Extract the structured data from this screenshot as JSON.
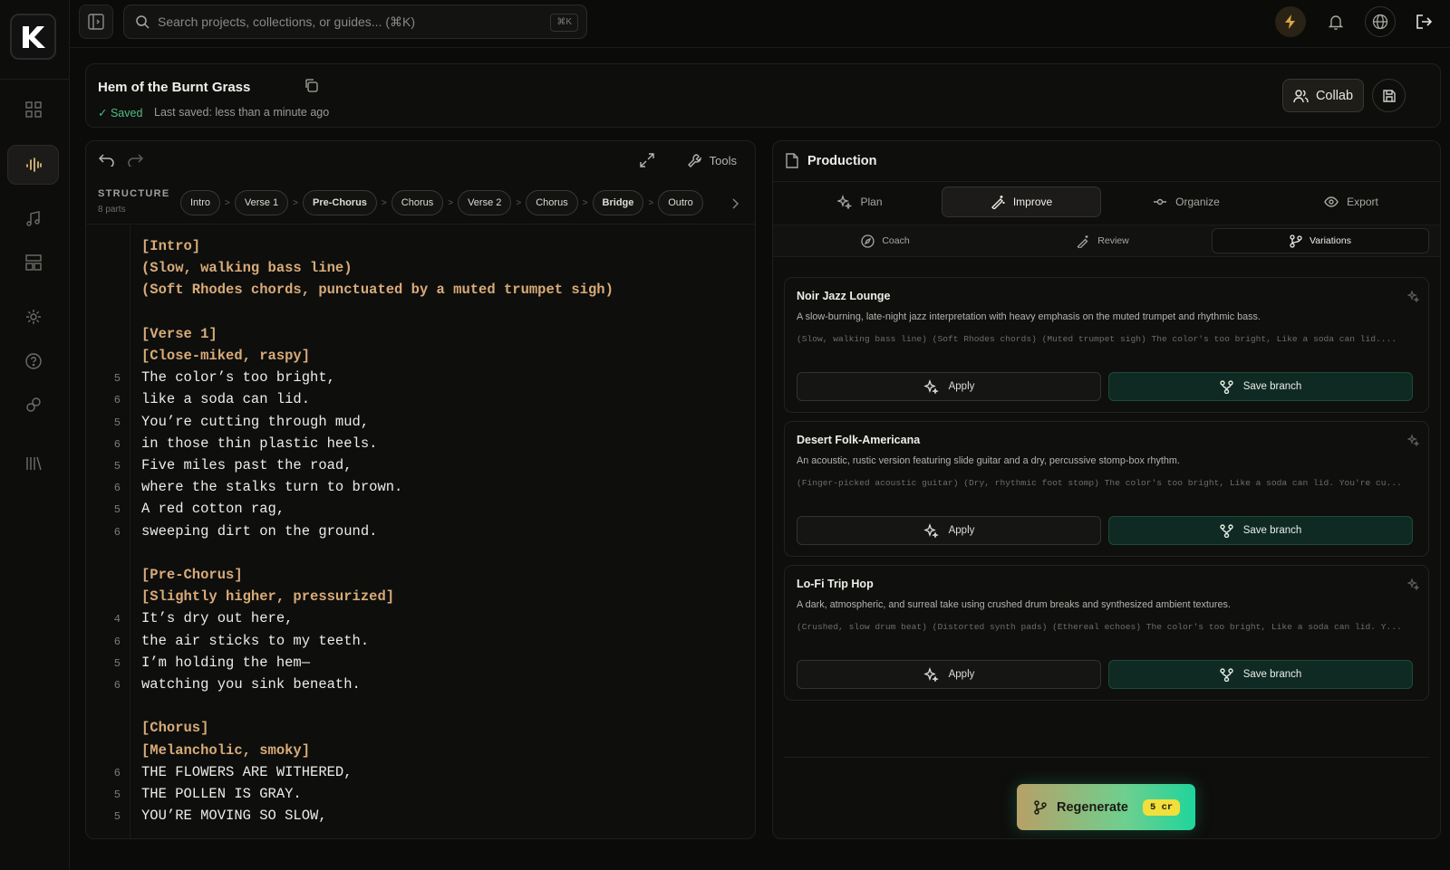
{
  "search": {
    "placeholder": "Search projects, collections, or guides... (⌘K)",
    "shortcut": "⌘K"
  },
  "project": {
    "title": "Hem of the Burnt Grass",
    "saved_label": "✓ Saved",
    "last_saved": "Last saved: less than a minute ago",
    "collab_label": "Collab"
  },
  "editor": {
    "tools_label": "Tools",
    "structure_label": "STRUCTURE",
    "structure_count": "8 parts",
    "parts": [
      "Intro",
      "Verse 1",
      "Pre-Chorus",
      "Chorus",
      "Verse 2",
      "Chorus",
      "Bridge",
      "Outro"
    ],
    "lines": [
      {
        "n": "",
        "t": "[Intro]",
        "tag": true
      },
      {
        "n": "",
        "t": "(Slow, walking bass line)",
        "tag": true
      },
      {
        "n": "",
        "t": "(Soft Rhodes chords, punctuated by a muted trumpet sigh)",
        "tag": true
      },
      {
        "n": "",
        "t": "",
        "tag": false
      },
      {
        "n": "",
        "t": "[Verse 1]",
        "tag": true
      },
      {
        "n": "",
        "t": "[Close-miked, raspy]",
        "tag": true
      },
      {
        "n": "5",
        "t": "The color’s too bright,",
        "tag": false
      },
      {
        "n": "6",
        "t": "like a soda can lid.",
        "tag": false
      },
      {
        "n": "5",
        "t": "You’re cutting through mud,",
        "tag": false
      },
      {
        "n": "6",
        "t": "in those thin plastic heels.",
        "tag": false
      },
      {
        "n": "5",
        "t": "Five miles past the road,",
        "tag": false
      },
      {
        "n": "6",
        "t": "where the stalks turn to brown.",
        "tag": false
      },
      {
        "n": "5",
        "t": "A red cotton rag,",
        "tag": false
      },
      {
        "n": "6",
        "t": "sweeping dirt on the ground.",
        "tag": false
      },
      {
        "n": "",
        "t": "",
        "tag": false
      },
      {
        "n": "",
        "t": "[Pre-Chorus]",
        "tag": true
      },
      {
        "n": "",
        "t": "[Slightly higher, pressurized]",
        "tag": true
      },
      {
        "n": "4",
        "t": "It’s dry out here,",
        "tag": false
      },
      {
        "n": "6",
        "t": "the air sticks to my teeth.",
        "tag": false
      },
      {
        "n": "5",
        "t": "I’m holding the hem—",
        "tag": false
      },
      {
        "n": "6",
        "t": "watching you sink beneath.",
        "tag": false
      },
      {
        "n": "",
        "t": "",
        "tag": false
      },
      {
        "n": "",
        "t": "[Chorus]",
        "tag": true
      },
      {
        "n": "",
        "t": "[Melancholic, smoky]",
        "tag": true
      },
      {
        "n": "6",
        "t": "THE FLOWERS ARE WITHERED,",
        "tag": false
      },
      {
        "n": "5",
        "t": "THE POLLEN IS GRAY.",
        "tag": false
      },
      {
        "n": "5",
        "t": "YOU’RE MOVING SO SLOW,",
        "tag": false
      }
    ]
  },
  "production": {
    "title": "Production",
    "tabs": [
      "Plan",
      "Improve",
      "Organize",
      "Export"
    ],
    "subtabs": [
      "Coach",
      "Review",
      "Variations"
    ],
    "apply_label": "Apply",
    "branch_label": "Save branch",
    "variations": [
      {
        "name": "Noir Jazz Lounge",
        "desc": "A slow-burning, late-night jazz interpretation with heavy emphasis on the muted trumpet and rhythmic bass.",
        "preview": "(Slow, walking bass line) (Soft Rhodes chords) (Muted trumpet sigh) The color's too bright, Like a soda can lid...."
      },
      {
        "name": "Desert Folk-Americana",
        "desc": "An acoustic, rustic version featuring slide guitar and a dry, percussive stomp-box rhythm.",
        "preview": "(Finger-picked acoustic guitar) (Dry, rhythmic foot stomp) The color's too bright, Like a soda can lid. You're cu..."
      },
      {
        "name": "Lo-Fi Trip Hop",
        "desc": "A dark, atmospheric, and surreal take using crushed drum breaks and synthesized ambient textures.",
        "preview": "(Crushed, slow drum beat) (Distorted synth pads) (Ethereal echoes) The color's too bright, Like a soda can lid. Y..."
      }
    ],
    "regenerate_label": "Regenerate",
    "credits": "5 cr"
  },
  "colors": {
    "accent_gold": "#d8ab78",
    "accent_green": "#1fd59b",
    "saved_green": "#4fbf83"
  }
}
